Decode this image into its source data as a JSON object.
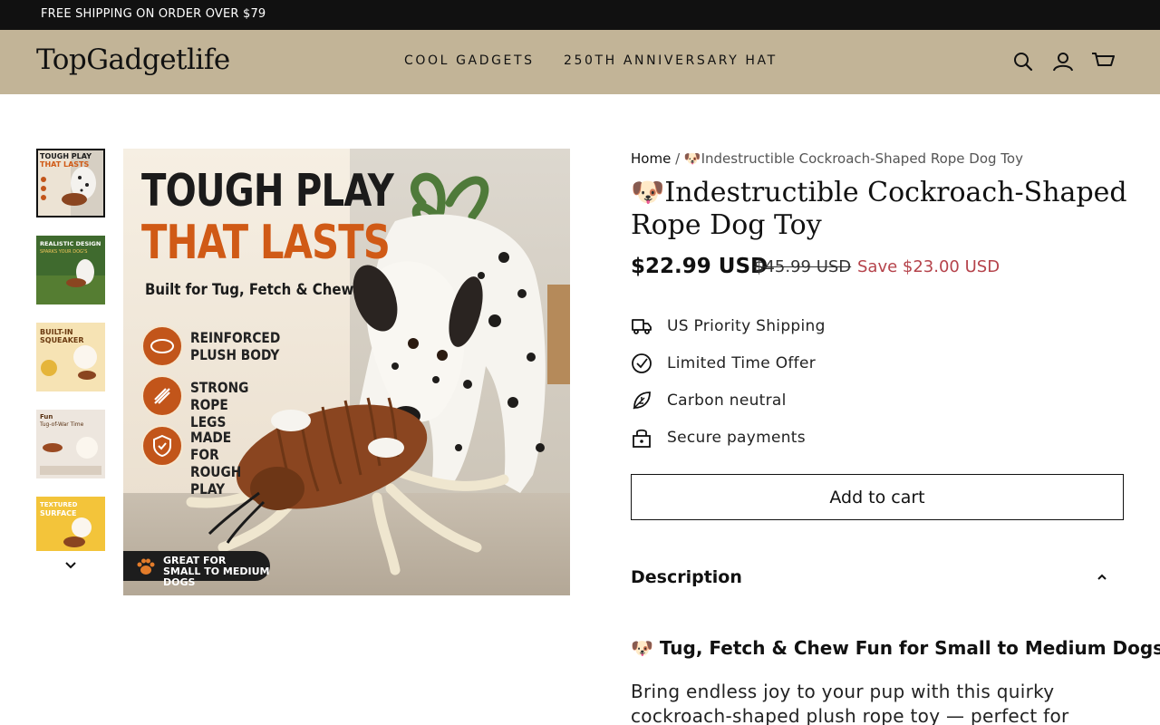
{
  "announcement": "FREE SHIPPING ON ORDER OVER $79",
  "header": {
    "logo": "TopGadgetlife",
    "nav": [
      "COOL GADGETS",
      "250TH ANNIVERSARY HAT"
    ],
    "icons": [
      "search-icon",
      "account-icon",
      "cart-icon"
    ]
  },
  "gallery": {
    "thumbnails": [
      {
        "caption": "TOUGH PLAY THAT LASTS",
        "active": true
      },
      {
        "caption": "REALISTIC DESIGN",
        "active": false
      },
      {
        "caption": "BUILT-IN SQUEAKER",
        "active": false
      },
      {
        "caption": "Fun Tug-of-War Time",
        "active": false
      },
      {
        "caption": "TEXTURED SURFACE",
        "active": false
      }
    ],
    "hero": {
      "headline_1": "TOUGH PLAY",
      "headline_2": "THAT LASTS",
      "subtitle": "Built for Tug, Fetch & Chew",
      "features": [
        "REINFORCED\nPLUSH BODY",
        "STRONG\nROPE LEGS",
        "MADE FOR\nROUGH PLAY"
      ],
      "badge": "GREAT FOR\nSMALL TO MEDIUM DOGS"
    }
  },
  "product": {
    "breadcrumb_home": "Home",
    "breadcrumb_sep": "/",
    "breadcrumb_current": "🐶Indestructible Cockroach-Shaped Rope Dog Toy",
    "title": "🐶Indestructible Cockroach-Shaped Rope Dog Toy",
    "price": "$22.99 USD",
    "compare_price": "$45.99 USD",
    "savings": "Save $23.00 USD",
    "bullets": [
      "US Priority Shipping",
      "Limited Time Offer",
      "Carbon neutral",
      "Secure payments"
    ],
    "add_to_cart": "Add to cart",
    "description_label": "Description",
    "description_heading": "🐶 Tug, Fetch & Chew Fun for Small to Medium Dogs",
    "description_text": "Bring endless joy to your pup with this quirky cockroach-shaped plush rope toy — perfect for"
  },
  "colors": {
    "header_bg": "#c2b497",
    "accent_orange": "#d05a16",
    "save_red": "#b5434b"
  }
}
